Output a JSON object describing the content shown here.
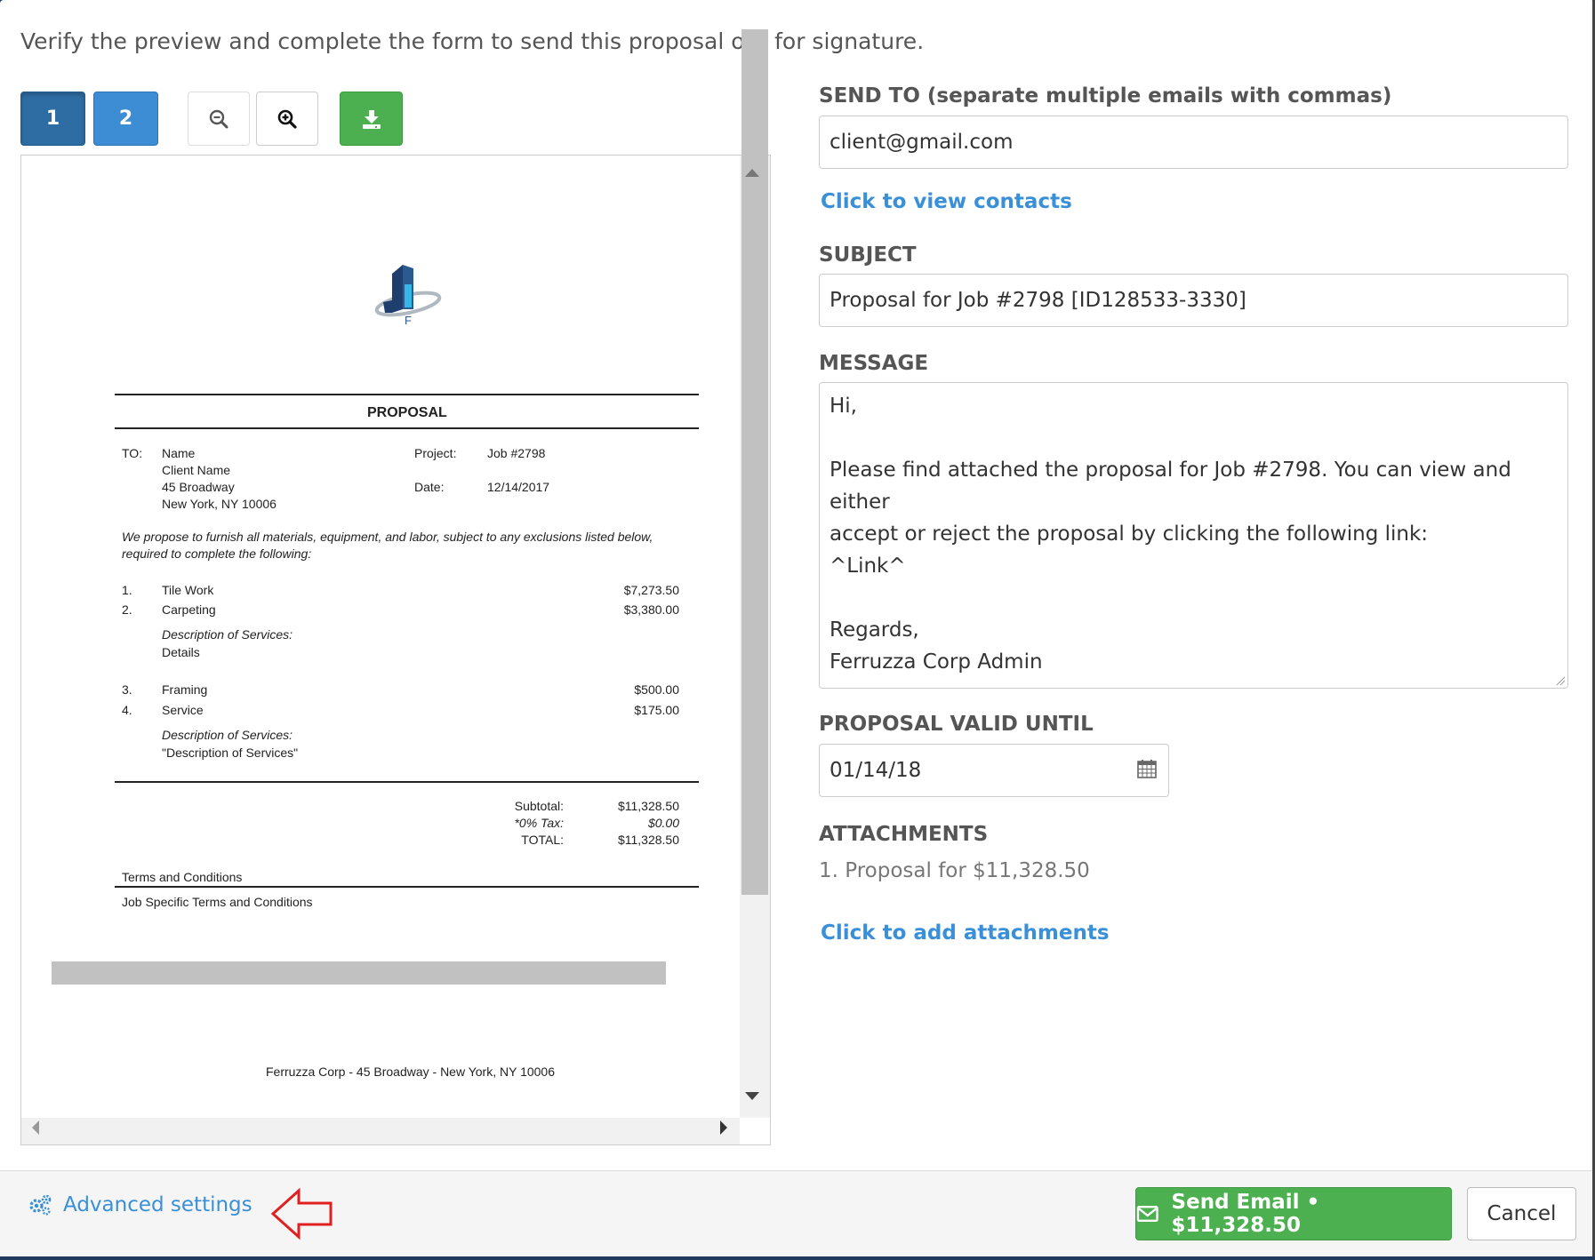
{
  "instructions": "Verify the preview and complete the form to send this proposal out for signature.",
  "toolbar": {
    "pages": [
      "1",
      "2"
    ],
    "zoom_out_icon": "zoom-out-icon",
    "zoom_in_icon": "zoom-in-icon",
    "download_icon": "download-icon"
  },
  "document": {
    "logo_letter": "F",
    "heading": "PROPOSAL",
    "to_label": "TO:",
    "to_lines": [
      "Name",
      "Client Name",
      "45 Broadway",
      "New York, NY 10006"
    ],
    "project_label": "Project:",
    "project_value": "Job #2798",
    "date_label": "Date:",
    "date_value": "12/14/2017",
    "intro_line1": "We propose to furnish all materials, equipment, and labor, subject to any exclusions listed below,",
    "intro_line2": "required to complete the following:",
    "items": [
      {
        "num": "1.",
        "name": "Tile Work",
        "amount": "$7,273.50"
      },
      {
        "num": "2.",
        "name": "Carpeting",
        "amount": "$3,380.00"
      },
      {
        "num": "3.",
        "name": "Framing",
        "amount": "$500.00"
      },
      {
        "num": "4.",
        "name": "Service",
        "amount": "$175.00"
      }
    ],
    "desc_label": "Description of Services:",
    "desc1_value": "Details",
    "desc2_value": "\"Description of Services\"",
    "subtotal_label": "Subtotal:",
    "subtotal_value": "$11,328.50",
    "tax_label": "*0% Tax:",
    "tax_value": "$0.00",
    "total_label": "TOTAL:",
    "total_value": "$11,328.50",
    "terms_heading": "Terms and Conditions",
    "terms_text": "Job Specific Terms and Conditions",
    "footer_text": "Ferruzza Corp - 45 Broadway - New York, NY 10006"
  },
  "form": {
    "send_to_label": "SEND TO (separate multiple emails with commas)",
    "send_to_value": "client@gmail.com",
    "view_contacts_link": "Click to view contacts",
    "subject_label": "SUBJECT",
    "subject_value": "Proposal for Job #2798 [ID128533-3330]",
    "message_label": "MESSAGE",
    "message_lines": [
      "Hi,",
      "",
      "Please find attached the proposal for Job #2798. You can view and either",
      "accept or reject the proposal by clicking the following link:",
      "^Link^",
      "",
      "Regards,",
      "Ferruzza Corp Admin"
    ],
    "valid_until_label": "PROPOSAL VALID UNTIL",
    "valid_until_value": "01/14/18",
    "calendar_icon": "calendar-icon",
    "attachments_label": "ATTACHMENTS",
    "attachments": [
      "1.  Proposal for $11,328.50"
    ],
    "add_attachments_link": "Click to add attachments"
  },
  "footer": {
    "advanced_settings": "Advanced settings",
    "send_button": "Send Email • $11,328.50",
    "cancel_button": "Cancel",
    "colors": {
      "accent": "#3a8fd9",
      "success": "#4cb050",
      "annotation": "#e02020"
    }
  }
}
